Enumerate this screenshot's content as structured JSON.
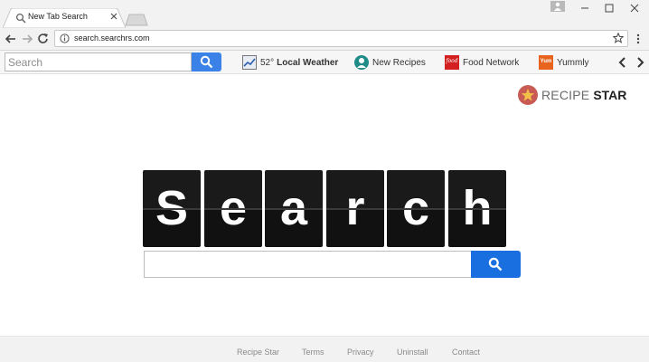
{
  "tab": {
    "title": "New Tab Search",
    "favicon": "search-icon"
  },
  "address_bar": {
    "url": "search.searchrs.com",
    "security_icon": "info-icon",
    "bookmark_icon": "star-icon"
  },
  "ext_toolbar": {
    "search_placeholder": "Search",
    "weather": {
      "temp": "52°",
      "label": "Local Weather"
    },
    "links": [
      {
        "label": "New Recipes",
        "icon": "chef-icon"
      },
      {
        "label": "Food Network",
        "icon": "food-network-icon",
        "icon_text": "food"
      },
      {
        "label": "Yummly",
        "icon": "yummly-icon",
        "icon_text": "Yum"
      }
    ]
  },
  "brand": {
    "part1": "RECIPE",
    "part2": "STAR"
  },
  "hero": {
    "letters": [
      "S",
      "e",
      "a",
      "r",
      "c",
      "h"
    ]
  },
  "footer": {
    "links": [
      "Recipe Star",
      "Terms",
      "Privacy",
      "Uninstall",
      "Contact"
    ]
  },
  "colors": {
    "accent": "#1a6fe0",
    "toolbar_search": "#3b82e8",
    "brand_badge": "#c85c55",
    "food_network": "#d32020",
    "yummly": "#e8641e"
  }
}
